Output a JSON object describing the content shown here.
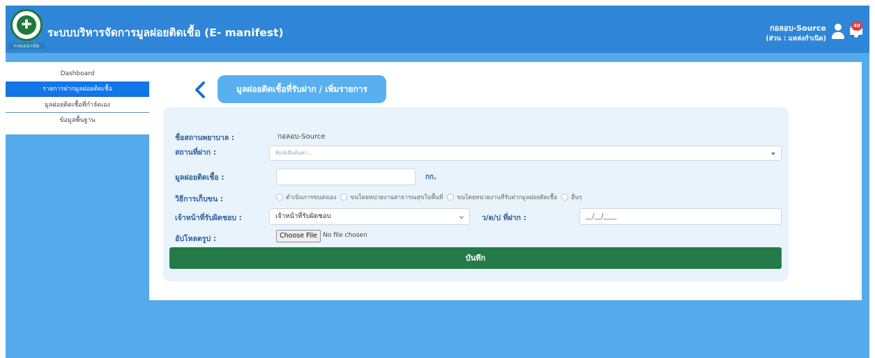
{
  "header": {
    "app_title": "ระบบบริหารจัดการมูลฝอยติดเชื้อ (E- manifest)",
    "logo_text": "กรมอนามัย",
    "user_name": "กอลอบ-Source",
    "user_role": "(ส่วน : แหล่งกำเนิด)",
    "notification_count": "40"
  },
  "sidebar": {
    "items": [
      {
        "label": "Dashboard"
      },
      {
        "label": "รายการฝากมูลฝอยติดเชื้อ"
      },
      {
        "label": "มูลฝอยติดเชื้อที่กำจัดเอง"
      },
      {
        "label": "ข้อมูลพื้นฐาน"
      }
    ]
  },
  "page": {
    "title": "มูลฝอยติดเชื้อที่รับฝาก / เพิ่มรายการ"
  },
  "form": {
    "hospital_label": "ชื่อสถานพยาบาล :",
    "hospital_value": "กอลอบ-Source",
    "deposit_place_label": "สถานที่ฝาก :",
    "deposit_place_placeholder": "พิมพ์เพื่อค้นหา...",
    "waste_label": "มูลฝอยติดเชื้อ :",
    "waste_value": "",
    "waste_unit": "กก.",
    "collection_label": "วิธีการเก็บขน :",
    "collection_options": [
      "ดำเนินการขนส่งเอง",
      "ขนโดยหน่วยงานสาธารณสุขในพื้นที่",
      "ขนโดยหน่วยงานที่รับฝากมูลฝอยติดเชื้อ",
      "อื่นๆ"
    ],
    "officer_label": "เจ้าหน้าที่รับผิดชอบ :",
    "officer_selected": "เจ้าหน้าที่รับผิดชอบ",
    "date_label": "ว/ด/ป ที่ฝาก :",
    "date_value": "__/__/____",
    "upload_label": "อัปโหลดรูป :",
    "choose_file_label": "Choose File",
    "file_status": "No file chosen",
    "save_label": "บันทึก"
  },
  "colors": {
    "header_bg": "#2f86d8",
    "page_bg": "#55aaec",
    "sidebar_active": "#1275e8",
    "save_button": "#237b47",
    "notification_badge": "#e63b3b"
  },
  "icons": {
    "logo": "department-of-health-logo",
    "back": "chevron-left-icon",
    "user": "user-icon",
    "bell": "bell-icon",
    "dropdown": "chevron-down-icon"
  }
}
